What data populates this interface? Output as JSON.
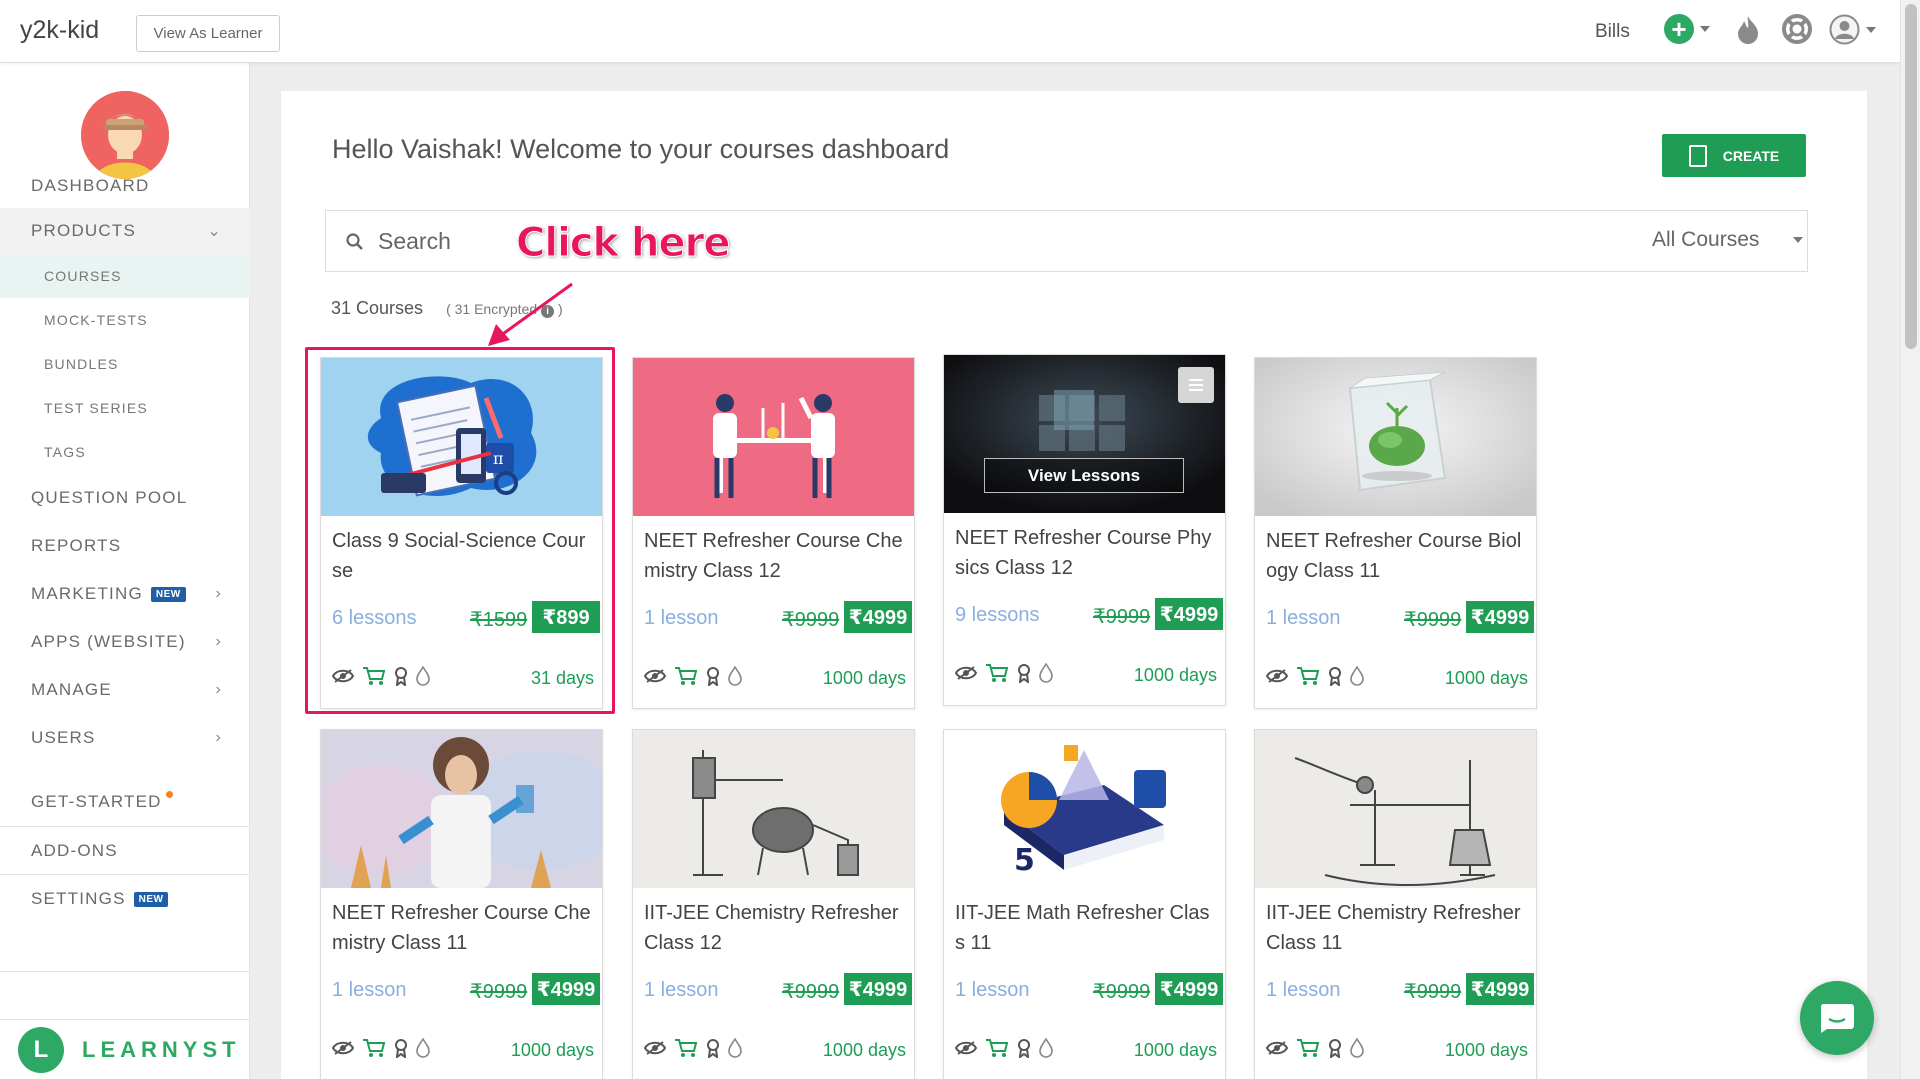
{
  "header": {
    "app_title": "y2k-kid",
    "view_as_learner": "View As Learner",
    "bills": "Bills"
  },
  "sidebar": {
    "items": [
      {
        "label": "DASHBOARD"
      },
      {
        "label": "PRODUCTS"
      },
      {
        "label": "QUESTION POOL"
      },
      {
        "label": "REPORTS"
      },
      {
        "label": "MARKETING",
        "badge": "NEW"
      },
      {
        "label": "APPS (WEBSITE)"
      },
      {
        "label": "MANAGE"
      },
      {
        "label": "USERS"
      },
      {
        "label": "GET-STARTED"
      },
      {
        "label": "ADD-ONS"
      },
      {
        "label": "SETTINGS",
        "badge": "NEW"
      }
    ],
    "sub_items": [
      {
        "label": "COURSES"
      },
      {
        "label": "MOCK-TESTS"
      },
      {
        "label": "BUNDLES"
      },
      {
        "label": "TEST SERIES"
      },
      {
        "label": "TAGS"
      }
    ],
    "brand": "LEARNYST",
    "brand_letter": "L"
  },
  "main": {
    "welcome": "Hello Vaishak! Welcome to your courses dashboard",
    "create_label": "CREATE",
    "search_placeholder": "Search",
    "filter_label": "All Courses",
    "course_count": "31 Courses",
    "encrypted_label": "( 31 Encrypted",
    "encrypted_close": ")",
    "annotation": "Click here",
    "view_lessons": "View Lessons"
  },
  "courses": [
    {
      "title": "Class 9 Social-Science Course",
      "lessons": "6 lessons",
      "old_price": "₹1599",
      "price": "₹899",
      "validity": "31 days"
    },
    {
      "title": "NEET Refresher Course Chemistry Class 12",
      "lessons": "1 lesson",
      "old_price": "₹9999",
      "price": "₹4999",
      "validity": "1000 days"
    },
    {
      "title": "NEET Refresher Course Physics Class 12",
      "lessons": "9 lessons",
      "old_price": "₹9999",
      "price": "₹4999",
      "validity": "1000 days"
    },
    {
      "title": "NEET Refresher Course Biology Class 11",
      "lessons": "1 lesson",
      "old_price": "₹9999",
      "price": "₹4999",
      "validity": "1000 days"
    },
    {
      "title": "NEET Refresher Course Chemistry Class 11",
      "lessons": "1 lesson",
      "old_price": "₹9999",
      "price": "₹4999",
      "validity": "1000 days"
    },
    {
      "title": "IIT-JEE Chemistry Refresher Class 12",
      "lessons": "1 lesson",
      "old_price": "₹9999",
      "price": "₹4999",
      "validity": "1000 days"
    },
    {
      "title": "IIT-JEE Math Refresher Class 11",
      "lessons": "1 lesson",
      "old_price": "₹9999",
      "price": "₹4999",
      "validity": "1000 days"
    },
    {
      "title": "IIT-JEE Chemistry Refresher Class 11",
      "lessons": "1 lesson",
      "old_price": "₹9999",
      "price": "₹4999",
      "validity": "1000 days"
    }
  ],
  "colors": {
    "accent_green": "#1f9d55",
    "annotation_pink": "#e8175d",
    "lesson_blue": "#8aaee0"
  },
  "icons": [
    "plus-icon",
    "fire-icon",
    "lifebuoy-icon",
    "user-icon",
    "search-icon",
    "document-icon",
    "hidden-eye-icon",
    "cart-icon",
    "award-icon",
    "drop-icon",
    "chat-icon"
  ]
}
